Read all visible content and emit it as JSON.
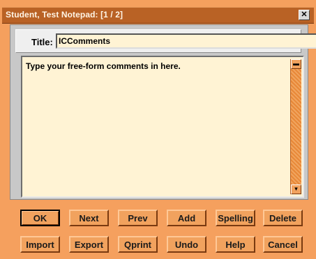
{
  "window": {
    "title": "Student, Test Notepad: [1 / 2]",
    "close_glyph": "✕"
  },
  "form": {
    "title_label": "Title:",
    "title_value": "ICComments",
    "notes_text": "Type your free-form comments in here."
  },
  "buttons": {
    "row1": [
      "OK",
      "Next",
      "Prev",
      "Add",
      "Spelling",
      "Delete"
    ],
    "row2": [
      "Import",
      "Export",
      "Qprint",
      "Undo",
      "Help",
      "Cancel"
    ]
  },
  "colors": {
    "background": "#f5a05e",
    "titlebar": "#b96225",
    "button": "#f1a25e",
    "input_bg": "#fff3d4"
  }
}
